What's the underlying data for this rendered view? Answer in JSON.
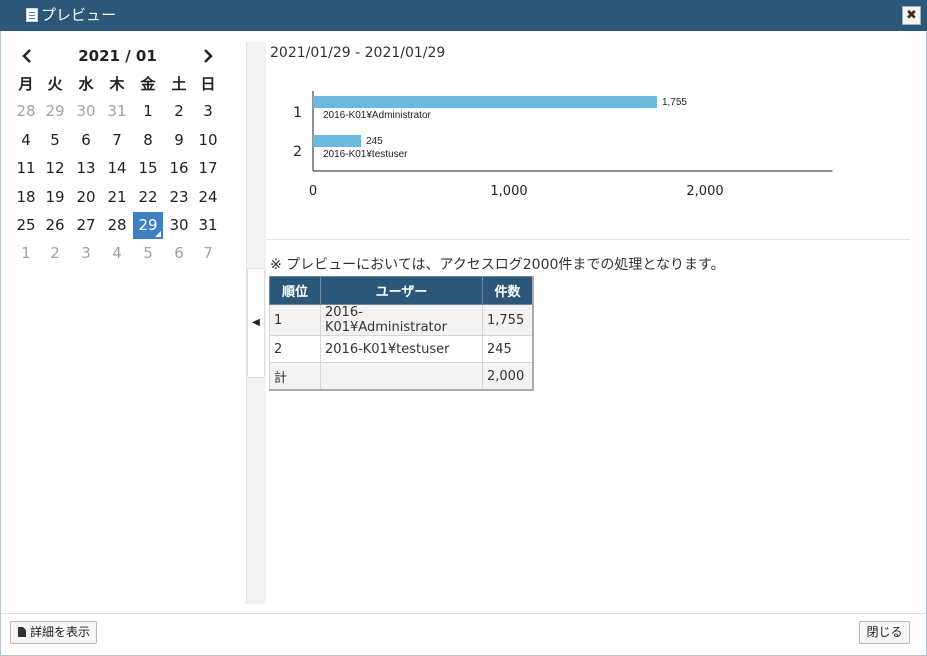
{
  "window": {
    "title": "プレビュー",
    "close_icon": "close-icon"
  },
  "calendar": {
    "month_label": "2021 / 01",
    "prev_icon": "chevron-left-icon",
    "next_icon": "chevron-right-icon",
    "weekdays": [
      "月",
      "火",
      "水",
      "木",
      "金",
      "土",
      "日"
    ],
    "weeks": [
      [
        {
          "d": "28",
          "other": true
        },
        {
          "d": "29",
          "other": true
        },
        {
          "d": "30",
          "other": true
        },
        {
          "d": "31",
          "other": true
        },
        {
          "d": "1",
          "other": false
        },
        {
          "d": "2",
          "other": false
        },
        {
          "d": "3",
          "other": false
        }
      ],
      [
        {
          "d": "4",
          "other": false
        },
        {
          "d": "5",
          "other": false
        },
        {
          "d": "6",
          "other": false
        },
        {
          "d": "7",
          "other": false
        },
        {
          "d": "8",
          "other": false
        },
        {
          "d": "9",
          "other": false
        },
        {
          "d": "10",
          "other": false
        }
      ],
      [
        {
          "d": "11",
          "other": false
        },
        {
          "d": "12",
          "other": false
        },
        {
          "d": "13",
          "other": false
        },
        {
          "d": "14",
          "other": false
        },
        {
          "d": "15",
          "other": false
        },
        {
          "d": "16",
          "other": false
        },
        {
          "d": "17",
          "other": false
        }
      ],
      [
        {
          "d": "18",
          "other": false
        },
        {
          "d": "19",
          "other": false
        },
        {
          "d": "20",
          "other": false
        },
        {
          "d": "21",
          "other": false
        },
        {
          "d": "22",
          "other": false
        },
        {
          "d": "23",
          "other": false
        },
        {
          "d": "24",
          "other": false
        }
      ],
      [
        {
          "d": "25",
          "other": false
        },
        {
          "d": "26",
          "other": false
        },
        {
          "d": "27",
          "other": false
        },
        {
          "d": "28",
          "other": false
        },
        {
          "d": "29",
          "other": false,
          "selected": true
        },
        {
          "d": "30",
          "other": false
        },
        {
          "d": "31",
          "other": false
        }
      ],
      [
        {
          "d": "1",
          "other": true
        },
        {
          "d": "2",
          "other": true
        },
        {
          "d": "3",
          "other": true
        },
        {
          "d": "4",
          "other": true
        },
        {
          "d": "5",
          "other": true
        },
        {
          "d": "6",
          "other": true
        },
        {
          "d": "7",
          "other": true
        }
      ]
    ],
    "selected_color": "#3f80c2"
  },
  "splitter": {
    "toggle_icon": "triangle-left-icon",
    "toggle_glyph": "◀"
  },
  "main": {
    "date_range": "2021/01/29 - 2021/01/29",
    "notice": "※ プレビューにおいては、アクセスログ2000件までの処理となります。"
  },
  "chart_data": {
    "type": "bar",
    "orientation": "horizontal",
    "categories": [
      "1",
      "2"
    ],
    "bar_labels": [
      "2016-K01¥Administrator",
      "2016-K01¥testuser"
    ],
    "values": [
      1755,
      245
    ],
    "value_labels": [
      "1,755",
      "245"
    ],
    "xlim": [
      0,
      2650
    ],
    "xticks": [
      0,
      1000,
      2000
    ],
    "xtick_labels": [
      "0",
      "1,000",
      "2,000"
    ],
    "bar_color": "#6bbade",
    "grid": false
  },
  "table": {
    "headers": [
      "順位",
      "ユーザー",
      "件数"
    ],
    "rows": [
      [
        "1",
        "2016-K01¥Administrator",
        "1,755"
      ],
      [
        "2",
        "2016-K01¥testuser",
        "245"
      ],
      [
        "計",
        "",
        "2,000"
      ]
    ],
    "header_color": "#2d5778"
  },
  "footer": {
    "details_label": "詳細を表示",
    "details_icon": "document-icon",
    "close_label": "閉じる"
  }
}
